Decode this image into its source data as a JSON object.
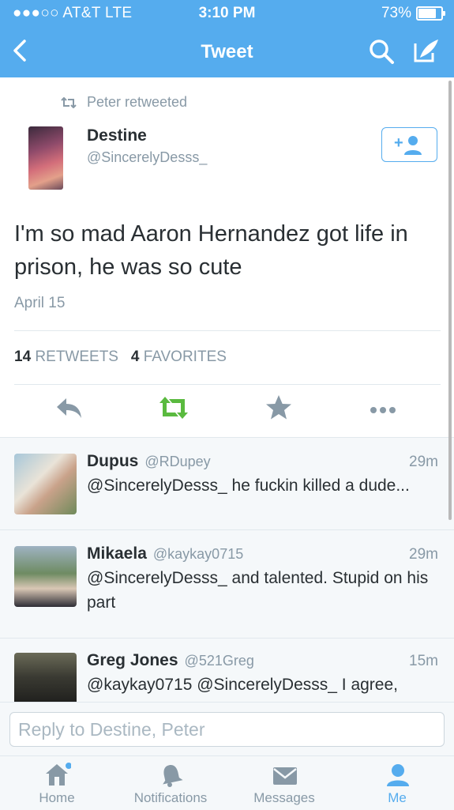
{
  "status_bar": {
    "carrier": "●●●○○ AT&T  LTE",
    "time": "3:10 PM",
    "battery": "73%"
  },
  "nav": {
    "title": "Tweet"
  },
  "tweet": {
    "retweeted_by": "Peter retweeted",
    "author_name": "Destine",
    "author_handle": "@SincerelyDesss_",
    "text": "I'm so mad Aaron Hernandez got life in prison, he was so cute",
    "date": "April 15",
    "retweets_count": "14",
    "retweets_label": "RETWEETS",
    "favorites_count": "4",
    "favorites_label": "FAVORITES"
  },
  "replies": [
    {
      "name": "Dupus",
      "handle": "@RDupey",
      "time": "29m",
      "text": "@SincerelyDesss_ he fuckin killed a dude..."
    },
    {
      "name": "Mikaela",
      "handle": "@kaykay0715",
      "time": "29m",
      "text": "@SincerelyDesss_ and talented. Stupid on his part"
    },
    {
      "name": "Greg Jones",
      "handle": "@521Greg",
      "time": "15m",
      "text": "@kaykay0715 @SincerelyDesss_ I agree,"
    }
  ],
  "reply_box": {
    "placeholder": "Reply to Destine, Peter"
  },
  "tabs": [
    {
      "label": "Home",
      "icon": "home-icon"
    },
    {
      "label": "Notifications",
      "icon": "bell-icon"
    },
    {
      "label": "Messages",
      "icon": "envelope-icon"
    },
    {
      "label": "Me",
      "icon": "person-icon"
    }
  ],
  "colors": {
    "brand": "#55acee",
    "retweet_active": "#5aba3f",
    "muted": "#8899a6",
    "text": "#292f33"
  }
}
